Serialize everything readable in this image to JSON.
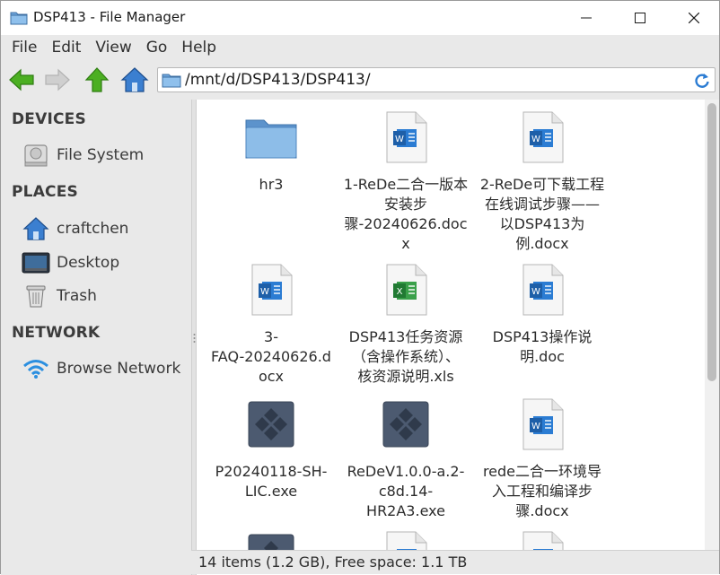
{
  "window": {
    "title": "DSP413 - File Manager",
    "icon": "folder-icon"
  },
  "menu": {
    "items": [
      "File",
      "Edit",
      "View",
      "Go",
      "Help"
    ]
  },
  "toolbar": {
    "back_icon": "back-arrow-icon",
    "forward_icon": "forward-arrow-icon",
    "up_icon": "up-arrow-icon",
    "home_icon": "home-icon",
    "location": "/mnt/d/DSP413/DSP413/",
    "reload_icon": "reload-icon"
  },
  "sidebar": {
    "devices_header": "DEVICES",
    "places_header": "PLACES",
    "network_header": "NETWORK",
    "devices": [
      {
        "label": "File System",
        "icon": "drive-icon"
      }
    ],
    "places": [
      {
        "label": "craftchen",
        "icon": "home-folder-icon"
      },
      {
        "label": "Desktop",
        "icon": "desktop-icon"
      },
      {
        "label": "Trash",
        "icon": "trash-icon"
      }
    ],
    "network": [
      {
        "label": "Browse Network",
        "icon": "wifi-icon"
      }
    ]
  },
  "files": [
    {
      "name": "hr3",
      "type": "folder"
    },
    {
      "name": "1-ReDe二合一版本\n安装步\n骤-20240626.doc\nx",
      "type": "docx"
    },
    {
      "name": "2-ReDe可下载工程\n在线调试步骤——\n以DSP413为\n例.docx",
      "type": "docx"
    },
    {
      "name": "3-\nFAQ-20240626.d\nocx",
      "type": "docx"
    },
    {
      "name": "DSP413任务资源\n（含操作系统）、\n核资源说明.xls",
      "type": "xls"
    },
    {
      "name": "DSP413操作说\n明.doc",
      "type": "docx"
    },
    {
      "name": "P20240118-SH-\nLIC.exe",
      "type": "exe"
    },
    {
      "name": "ReDeV1.0.0-a.2-\nc8d.14-\nHR2A3.exe",
      "type": "exe"
    },
    {
      "name": "rede二合一环境导\n入工程和编译步\n骤.docx",
      "type": "docx"
    },
    {
      "name": "",
      "type": "exe"
    },
    {
      "name": "",
      "type": "docx"
    },
    {
      "name": "",
      "type": "docx"
    }
  ],
  "status": {
    "text": "14 items (1.2 GB), Free space: 1.1 TB"
  },
  "colors": {
    "chrome": "#e9e9e9",
    "word_blue": "#2b7cd3",
    "excel_green": "#3aa04a",
    "exe_slate": "#4c5a70",
    "folder_blue": "#7fb0de"
  }
}
